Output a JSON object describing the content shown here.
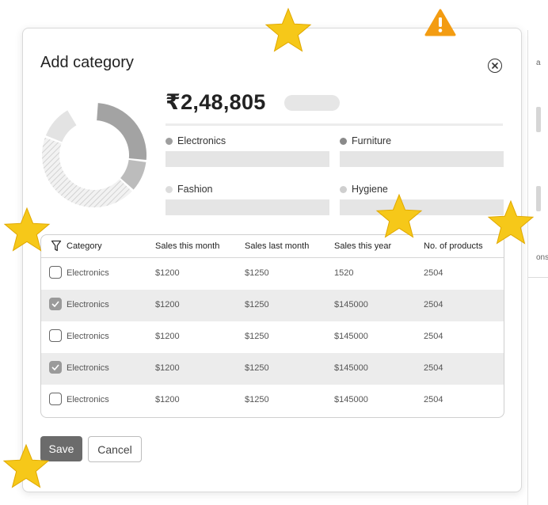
{
  "modal": {
    "title": "Add category",
    "total": "₹2,48,805",
    "legend": [
      {
        "label": "Electronics",
        "dot_color": "#9e9e9e"
      },
      {
        "label": "Furniture",
        "dot_color": "#8a8a8a"
      },
      {
        "label": "Fashion",
        "dot_color": "#dcdcdc"
      },
      {
        "label": "Hygiene",
        "dot_color": "#cfcfcf"
      }
    ],
    "donut_segments": [
      {
        "label": "Electronics",
        "fraction": 0.26,
        "color": "#a3a3a3"
      },
      {
        "label": "Furniture",
        "fraction": 0.1,
        "color": "#bcbcbc"
      },
      {
        "label": "Fashion",
        "fraction": 0.44,
        "pattern": "hatched"
      },
      {
        "label": "Hygiene",
        "fraction": 0.11,
        "color": "#e3e3e3"
      }
    ],
    "table": {
      "headers": [
        "Category",
        "Sales this month",
        "Sales last month",
        "Sales this year",
        "No. of products"
      ],
      "rows": [
        {
          "checked": false,
          "category": "Electronics",
          "this_month": "$1200",
          "last_month": "$1250",
          "this_year": "1520",
          "products": "2504"
        },
        {
          "checked": true,
          "category": "Electronics",
          "this_month": "$1200",
          "last_month": "$1250",
          "this_year": "$145000",
          "products": "2504"
        },
        {
          "checked": false,
          "category": "Electronics",
          "this_month": "$1200",
          "last_month": "$1250",
          "this_year": "$145000",
          "products": "2504"
        },
        {
          "checked": true,
          "category": "Electronics",
          "this_month": "$1200",
          "last_month": "$1250",
          "this_year": "$145000",
          "products": "2504"
        },
        {
          "checked": false,
          "category": "Electronics",
          "this_month": "$1200",
          "last_month": "$1250",
          "this_year": "$145000",
          "products": "2504"
        }
      ]
    },
    "buttons": {
      "save": "Save",
      "cancel": "Cancel"
    }
  },
  "background_page": {
    "fragments": [
      "a",
      "ons"
    ]
  },
  "colors": {
    "star": "#f6c819",
    "warning": "#f39c12",
    "save_button": "#6b6b6b"
  },
  "icons": [
    "close-icon",
    "filter-icon",
    "checkbox-check-icon",
    "star-icon",
    "warning-icon"
  ]
}
